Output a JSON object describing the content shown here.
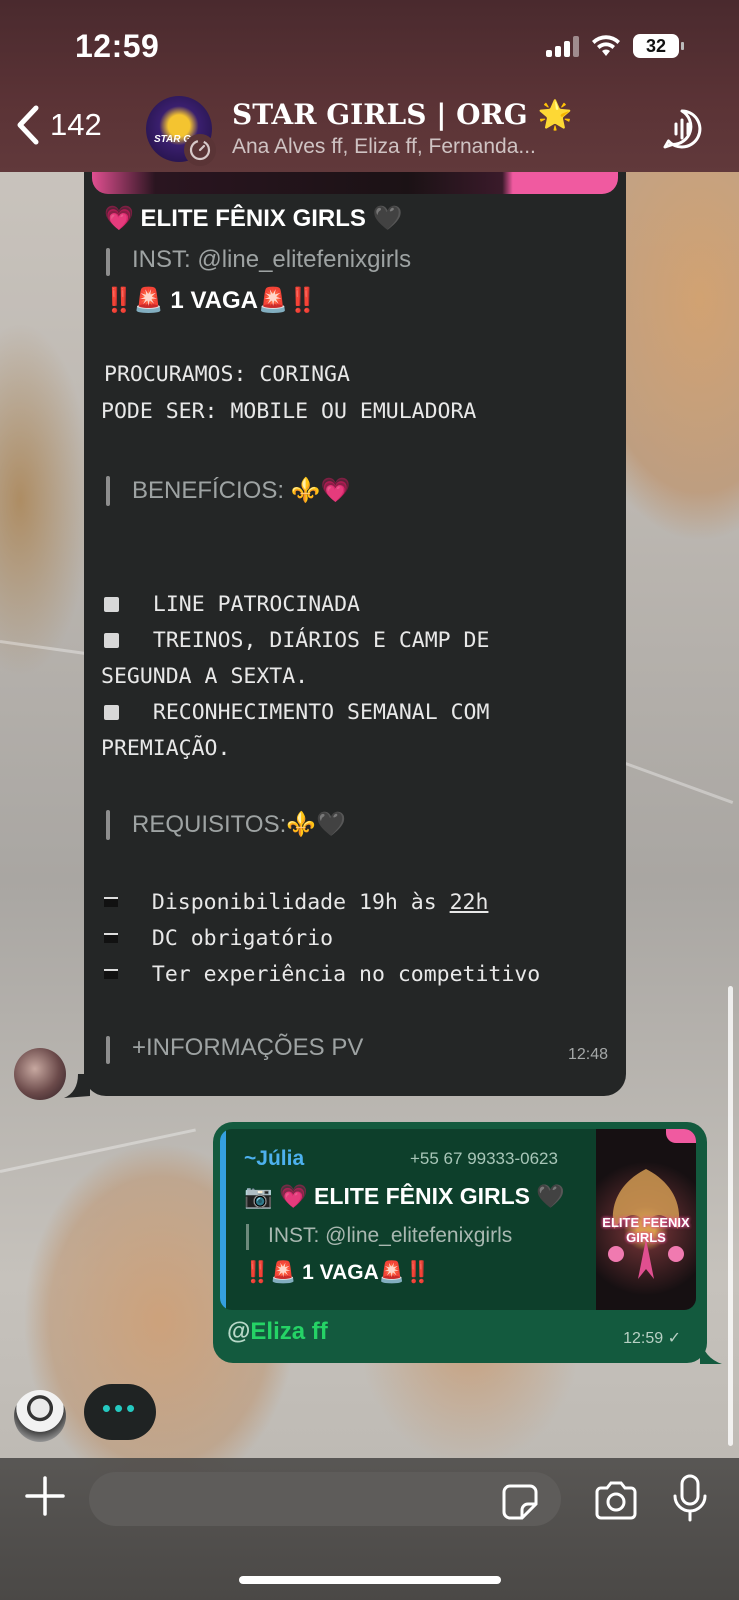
{
  "status_bar": {
    "time": "12:59",
    "battery": "32"
  },
  "header": {
    "back_count": "142",
    "avatar_tag": "STAR G",
    "group_name": "STAR GIRLS | ORG 🌟",
    "participants": "Ana Alves ff, Eliza ff, Fernanda..."
  },
  "incoming_message": {
    "title": "💗 ELITE FÊNIX  GIRLS 🖤",
    "inst": "INST: @line_elitefenixgirls",
    "vaga": "‼️🚨 1 VAGA🚨‼️",
    "procuramos": "PROCURAMOS: CORINGA",
    "pode_ser": "PODE SER: MOBILE OU EMULADORA",
    "beneficios_heading": "BENEFÍCIOS: ⚜️💗",
    "benefit_1": "LINE PATROCINADA",
    "benefit_2a": "TREINOS, DIÁRIOS E CAMP DE",
    "benefit_2b": "SEGUNDA A SEXTA.",
    "benefit_3a": "RECONHECIMENTO SEMANAL COM",
    "benefit_3b": "PREMIAÇÃO.",
    "requisitos_heading": "REQUISITOS:⚜️🖤",
    "req_1_prefix": "Disponibilidade 19h às ",
    "req_1_time": "22h",
    "req_2": "DC obrigatório",
    "req_3": "Ter experiência no competitivo",
    "more_info": "+INFORMAÇÕES PV",
    "time": "12:48"
  },
  "outgoing_message": {
    "reply_name": "~Júlia",
    "reply_phone": "+55 67 99333-0623",
    "reply_title": "📷 💗 ELITE FÊNIX  GIRLS 🖤",
    "reply_inst": "INST: @line_elitefenixgirls",
    "reply_vaga": "‼️🚨 1 VAGA🚨‼️",
    "thumb_text": "ELITE FEENIX GIRLS",
    "mention_at": "@",
    "mention_name": "Eliza ff",
    "time": "12:59 ✓"
  },
  "typing_indicator": "•••",
  "composer": {
    "placeholder": ""
  },
  "icons": [
    "chevron-left-icon",
    "call-icon",
    "plus-icon",
    "sticker-icon",
    "camera-icon",
    "microphone-icon"
  ]
}
